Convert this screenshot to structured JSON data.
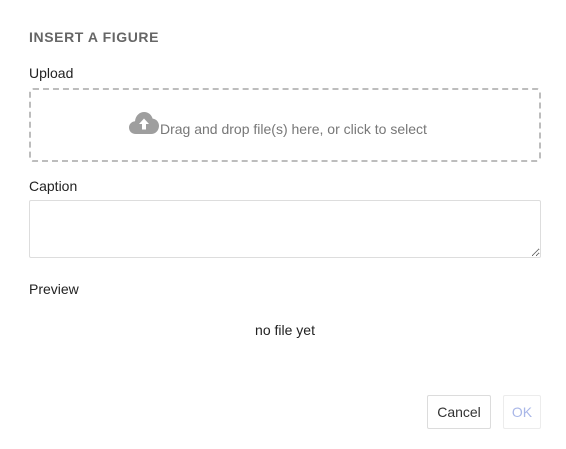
{
  "dialog": {
    "title": "INSERT A FIGURE",
    "upload": {
      "label": "Upload",
      "dropzone_text": "Drag and drop file(s) here, or click to select",
      "icon": "cloud-upload-icon"
    },
    "caption": {
      "label": "Caption",
      "value": "",
      "placeholder": ""
    },
    "preview": {
      "label": "Preview",
      "empty_text": "no file yet"
    },
    "buttons": {
      "cancel_label": "Cancel",
      "ok_label": "OK"
    },
    "colors": {
      "ok_disabled_text": "#a9b7e8",
      "icon_gray": "#9e9e9e"
    }
  }
}
